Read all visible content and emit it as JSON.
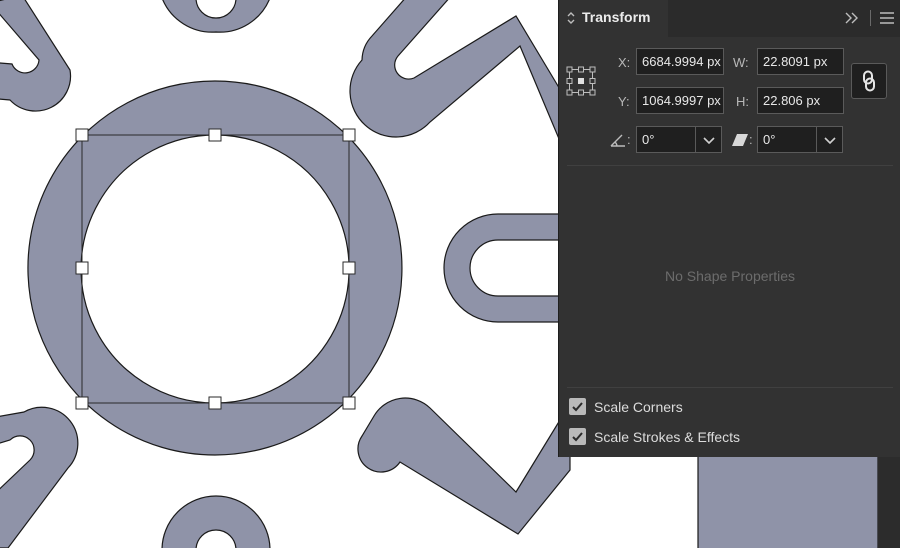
{
  "panel": {
    "tab_title": "Transform",
    "x_label": "X:",
    "x_value": "6684.9994 px",
    "y_label": "Y:",
    "y_value": "1064.9997 px",
    "w_label": "W:",
    "w_value": "22.8091 px",
    "h_label": "H:",
    "h_value": "22.806 px",
    "rotate_label": ":",
    "rotate_value": "0°",
    "shear_label": ":",
    "shear_value": "0°",
    "empty_message": "No Shape Properties",
    "scale_corners_label": "Scale Corners",
    "scale_corners_checked": true,
    "scale_strokes_label": "Scale Strokes & Effects",
    "scale_strokes_checked": true,
    "constrain_proportions_on": true
  },
  "icons": {
    "tab_arrow": "collapse-expand-arrows-icon",
    "collapse": "double-chevron-right-icon",
    "menu": "hamburger-menu-icon",
    "reference_point": "reference-point-grid-icon",
    "constrain": "link-chain-icon",
    "rotate": "angle-icon",
    "shear": "shear-icon",
    "dropdown": "chevron-down-icon",
    "checkbox": "checkmark-icon"
  },
  "colors": {
    "artwork_fill": "#8f93a8",
    "artwork_stroke": "#1a1a1a",
    "panel_bg": "#323232",
    "tab_bar_bg": "#2b2b2b",
    "field_bg": "#1f1f1f",
    "canvas_bg": "#ffffff"
  }
}
